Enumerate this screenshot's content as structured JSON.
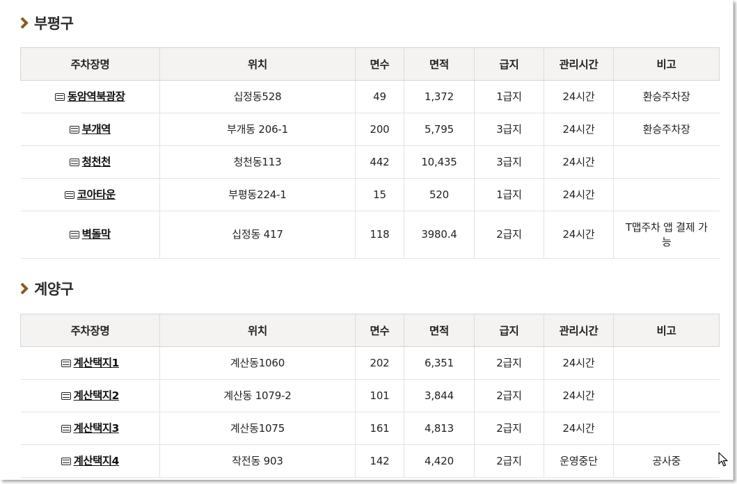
{
  "sections": [
    {
      "title": "부평구",
      "headers": [
        "주차장명",
        "위치",
        "면수",
        "면적",
        "급지",
        "관리시간",
        "비고"
      ],
      "rows": [
        {
          "name": "동암역북광장",
          "location": "십정동528",
          "spaces": "49",
          "area": "1,372",
          "grade": "1급지",
          "hours": "24시간",
          "note": "환승주차장"
        },
        {
          "name": "부개역",
          "location": "부개동 206-1",
          "spaces": "200",
          "area": "5,795",
          "grade": "3급지",
          "hours": "24시간",
          "note": "환승주차장"
        },
        {
          "name": "청천천",
          "location": "청천동113",
          "spaces": "442",
          "area": "10,435",
          "grade": "3급지",
          "hours": "24시간",
          "note": ""
        },
        {
          "name": "코아타운",
          "location": "부평동224-1",
          "spaces": "15",
          "area": "520",
          "grade": "1급지",
          "hours": "24시간",
          "note": ""
        },
        {
          "name": "벽돌막",
          "location": "십정동 417",
          "spaces": "118",
          "area": "3980.4",
          "grade": "2급지",
          "hours": "24시간",
          "note": "T맵주차 앱 결제 가능"
        }
      ]
    },
    {
      "title": "계양구",
      "headers": [
        "주차장명",
        "위치",
        "면수",
        "면적",
        "급지",
        "관리시간",
        "비고"
      ],
      "rows": [
        {
          "name": "계산택지1",
          "location": "계산동1060",
          "spaces": "202",
          "area": "6,351",
          "grade": "2급지",
          "hours": "24시간",
          "note": ""
        },
        {
          "name": "계산택지2",
          "location": "계산동 1079-2",
          "spaces": "101",
          "area": "3,844",
          "grade": "2급지",
          "hours": "24시간",
          "note": ""
        },
        {
          "name": "계산택지3",
          "location": "계산동1075",
          "spaces": "161",
          "area": "4,813",
          "grade": "2급지",
          "hours": "24시간",
          "note": ""
        },
        {
          "name": "계산택지4",
          "location": "작전동 903",
          "spaces": "142",
          "area": "4,420",
          "grade": "2급지",
          "hours": "운영중단",
          "note": "공사중"
        }
      ]
    }
  ],
  "icons": {
    "section": "chevron-right-icon",
    "parking": "bus-icon",
    "cursor": "mouse-cursor-icon"
  },
  "colors": {
    "chevron": "#8a5a1c",
    "header_bg": "#f4f3f1"
  }
}
